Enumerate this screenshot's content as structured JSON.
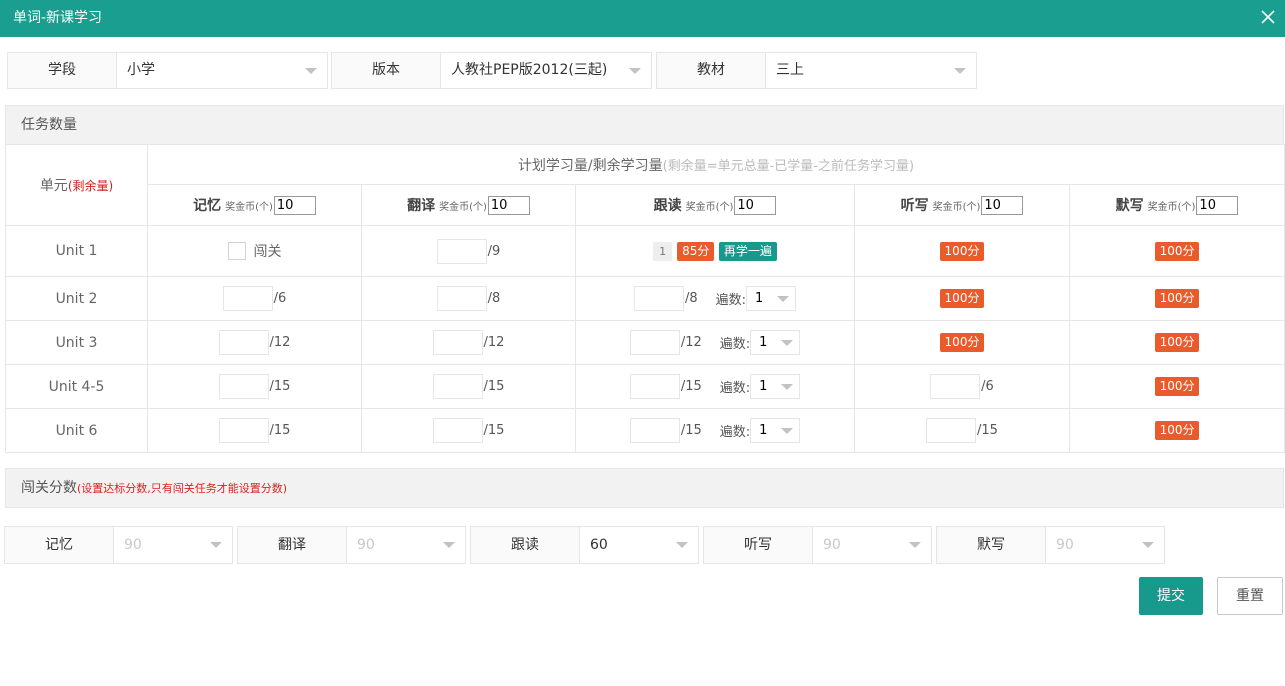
{
  "dialog": {
    "title": "单词-新课学习",
    "close_icon": "close-icon"
  },
  "filters": [
    {
      "label": "学段",
      "value": "小学"
    },
    {
      "label": "版本",
      "value": "人教社PEP版2012(三起)"
    },
    {
      "label": "教材",
      "value": "三上"
    }
  ],
  "tasks": {
    "section_title": "任务数量",
    "unit_header": "单元",
    "unit_header_note": "(剩余量)",
    "plan_header": "计划学习量/剩余学习量",
    "plan_header_note": "(剩余量=单元总量-已学量-之前任务学习量)",
    "coin_label": "奖金币(个)",
    "columns": [
      {
        "name": "记忆",
        "coins": "10"
      },
      {
        "name": "翻译",
        "coins": "10"
      },
      {
        "name": "跟读",
        "coins": "10"
      },
      {
        "name": "听写",
        "coins": "10"
      },
      {
        "name": "默写",
        "coins": "10"
      }
    ],
    "pass_label": "闯关",
    "times_label": "遍数:",
    "rows": [
      {
        "unit": "Unit 1",
        "memory_total": "",
        "translate_total": "/9",
        "read_count": "1",
        "read_score": "85分",
        "read_again": "再学一遍",
        "dictation_score": "100分",
        "write_score": "100分"
      },
      {
        "unit": "Unit 2",
        "memory_total": "/6",
        "translate_total": "/8",
        "read_total": "/8",
        "read_times": "1",
        "dictation_score": "100分",
        "write_score": "100分"
      },
      {
        "unit": "Unit 3",
        "memory_total": "/12",
        "translate_total": "/12",
        "read_total": "/12",
        "read_times": "1",
        "dictation_score": "100分",
        "write_score": "100分"
      },
      {
        "unit": "Unit 4-5",
        "memory_total": "/15",
        "translate_total": "/15",
        "read_total": "/15",
        "read_times": "1",
        "dictation_total": "/6",
        "write_score": "100分"
      },
      {
        "unit": "Unit 6",
        "memory_total": "/15",
        "translate_total": "/15",
        "read_total": "/15",
        "read_times": "1",
        "dictation_total": "/15",
        "write_score": "100分"
      }
    ]
  },
  "scores": {
    "section_title": "闯关分数",
    "section_note": "(设置达标分数,只有闯关任务才能设置分数)",
    "items": [
      {
        "label": "记忆",
        "value": "90",
        "enabled": false
      },
      {
        "label": "翻译",
        "value": "90",
        "enabled": false
      },
      {
        "label": "跟读",
        "value": "60",
        "enabled": true
      },
      {
        "label": "听写",
        "value": "90",
        "enabled": false
      },
      {
        "label": "默写",
        "value": "90",
        "enabled": false
      }
    ]
  },
  "actions": {
    "submit": "提交",
    "reset": "重置"
  },
  "colors": {
    "accent": "#1a9e8f",
    "badge_orange": "#ea5b2c",
    "note_red": "#e02020"
  }
}
